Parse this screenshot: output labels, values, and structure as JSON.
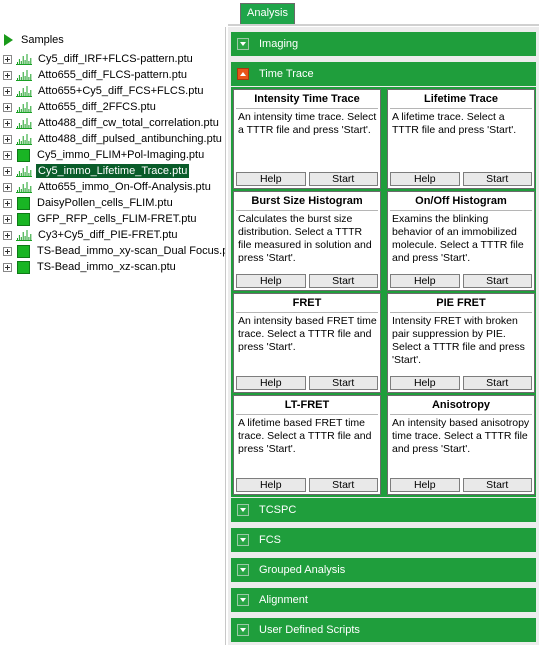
{
  "tabs": {
    "analysis_label": "Analysis"
  },
  "tree": {
    "root_label": "Samples",
    "items": [
      {
        "label": "Cy5_diff_IRF+FLCS-pattern.ptu",
        "icon": "waveform-icon",
        "selected": false
      },
      {
        "label": "Atto655_diff_FLCS-pattern.ptu",
        "icon": "waveform-icon",
        "selected": false
      },
      {
        "label": "Atto655+Cy5_diff_FCS+FLCS.ptu",
        "icon": "waveform-icon",
        "selected": false
      },
      {
        "label": "Atto655_diff_2FFCS.ptu",
        "icon": "waveform-icon",
        "selected": false
      },
      {
        "label": "Atto488_diff_cw_total_correlation.ptu",
        "icon": "waveform-icon",
        "selected": false
      },
      {
        "label": "Atto488_diff_pulsed_antibunching.ptu",
        "icon": "waveform-icon",
        "selected": false
      },
      {
        "label": "Cy5_immo_FLIM+Pol-Imaging.ptu",
        "icon": "image-square-icon",
        "selected": false
      },
      {
        "label": "Cy5_immo_Lifetime_Trace.ptu",
        "icon": "waveform-icon",
        "selected": true
      },
      {
        "label": "Atto655_immo_On-Off-Analysis.ptu",
        "icon": "waveform-icon",
        "selected": false
      },
      {
        "label": "DaisyPollen_cells_FLIM.ptu",
        "icon": "image-square-icon",
        "selected": false
      },
      {
        "label": "GFP_RFP_cells_FLIM-FRET.ptu",
        "icon": "image-square-icon",
        "selected": false
      },
      {
        "label": "Cy3+Cy5_diff_PIE-FRET.ptu",
        "icon": "waveform-icon",
        "selected": false
      },
      {
        "label": "TS-Bead_immo_xy-scan_Dual Focus.p",
        "icon": "image-square-icon",
        "selected": false
      },
      {
        "label": "TS-Bead_immo_xz-scan.ptu",
        "icon": "image-square-icon",
        "selected": false
      }
    ]
  },
  "sections": [
    {
      "title": "Imaging",
      "expanded": false
    },
    {
      "title": "Time Trace",
      "expanded": true
    },
    {
      "title": "TCSPC",
      "expanded": false
    },
    {
      "title": "FCS",
      "expanded": false
    },
    {
      "title": "Grouped Analysis",
      "expanded": false
    },
    {
      "title": "Alignment",
      "expanded": false
    },
    {
      "title": "User Defined Scripts",
      "expanded": false
    }
  ],
  "cards": [
    {
      "title": "Intensity Time Trace",
      "text": "An intensity time trace. Select a TTTR file and press 'Start'.",
      "help": "Help",
      "start": "Start"
    },
    {
      "title": "Lifetime Trace",
      "text": "A lifetime trace. Select a TTTR file and press 'Start'.",
      "help": "Help",
      "start": "Start"
    },
    {
      "title": "Burst Size Histogram",
      "text": "Calculates the burst size distribution. Select a TTTR file measured in solution and press 'Start'.",
      "help": "Help",
      "start": "Start"
    },
    {
      "title": "On/Off Histogram",
      "text": "Examins the blinking behavior of an immobilized molecule. Select a TTTR file and press 'Start'.",
      "help": "Help",
      "start": "Start"
    },
    {
      "title": "FRET",
      "text": "An intensity based FRET time trace. Select a TTTR file and press 'Start'.",
      "help": "Help",
      "start": "Start"
    },
    {
      "title": "PIE FRET",
      "text": "Intensity FRET with broken pair suppression by PIE. Select a TTTR file and press 'Start'.",
      "help": "Help",
      "start": "Start"
    },
    {
      "title": "LT-FRET",
      "text": "A lifetime based FRET time trace. Select a TTTR file and press 'Start'.",
      "help": "Help",
      "start": "Start"
    },
    {
      "title": "Anisotropy",
      "text": "An intensity based anisotropy time trace. Select a TTTR file and press 'Start'.",
      "help": "Help",
      "start": "Start"
    }
  ],
  "colors": {
    "section_green": "#1f9e3c",
    "tab_green": "#1fa54a",
    "selected_bg": "#0a5c2a",
    "expanded_toggle": "#e8541a",
    "icon_green": "#19b524"
  }
}
